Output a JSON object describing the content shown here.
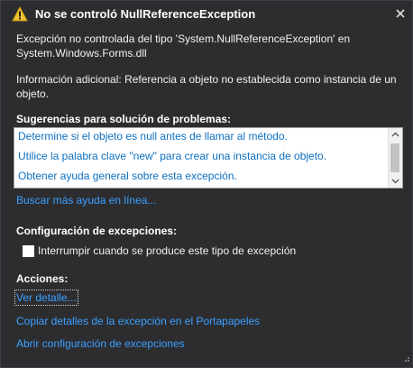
{
  "dialog": {
    "title": "No se controló NullReferenceException",
    "close_icon": "close-icon",
    "warning_icon": "warning-icon",
    "accent_color": "#0e70c0",
    "link_color": "#3aa0ff"
  },
  "message": {
    "line1": "Excepción no controlada del tipo 'System.NullReferenceException' en",
    "line2": "System.Windows.Forms.dll",
    "info_line1": "Información adicional: Referencia a objeto no establecida como instancia de un",
    "info_line2": "objeto."
  },
  "suggestions": {
    "heading": "Sugerencias para solución de problemas:",
    "items": [
      "Determine si el objeto es null antes de llamar al método.",
      "Utilice la palabra clave \"new\" para crear una instancia de objeto.",
      "Obtener ayuda general sobre esta excepción."
    ],
    "more_help_link": "Buscar más ayuda en línea..."
  },
  "exception_settings": {
    "heading": "Configuración de excepciones:",
    "checkbox_label": "Interrumpir cuando se produce este tipo de excepción",
    "checked": false
  },
  "actions": {
    "heading": "Acciones:",
    "links": [
      "Ver detalle...",
      "Copiar detalles de la excepción en el Portapapeles",
      "Abrir configuración de excepciones"
    ]
  }
}
